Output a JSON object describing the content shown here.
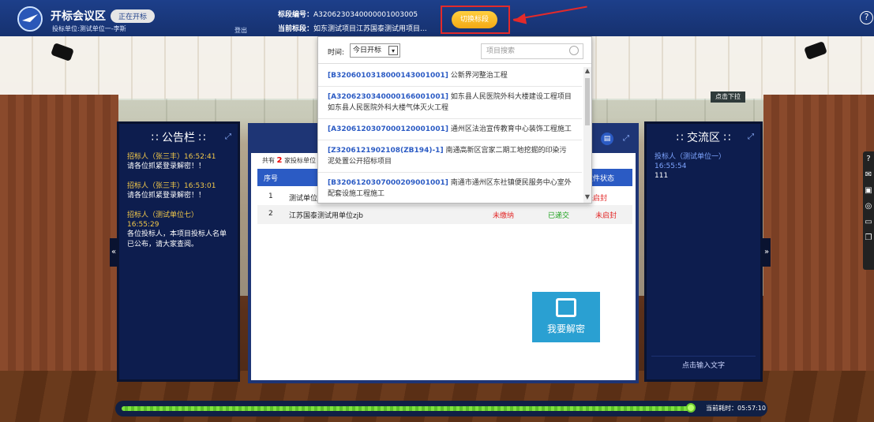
{
  "header": {
    "app_title": "开标会议区",
    "status": "正在开标",
    "bidder_info": "投标单位:测试单位一-李斯",
    "logout": "登出",
    "section_no_label": "标段编号：",
    "section_no_value": "A3206230340000001003005",
    "current_label": "当前标段：",
    "current_value": "如东测试项目江苏国泰测试用项目...",
    "switch_button": "切换标段",
    "help": "?"
  },
  "popup": {
    "time_label": "时间:",
    "time_value": "今日开标",
    "search_placeholder": "项目搜索",
    "items": [
      {
        "code": "[B3206010318000143001001]",
        "name": "公新界河整治工程"
      },
      {
        "code": "[A3206230340000166001001]",
        "name": "如东县人民医院外科大楼建设工程项目如东县人民医院外科大楼气体灭火工程"
      },
      {
        "code": "[A3206120307000120001001]",
        "name": "通州区法治宣传教育中心装饰工程施工"
      },
      {
        "code": "[Z3206121902108(ZB194)-1]",
        "name": "南通高新区宫家二期工地挖掘的印染污泥处置公开招标项目"
      },
      {
        "code": "[B3206120307000209001001]",
        "name": "南通市通州区东社镇便民服务中心室外配套设施工程施工"
      }
    ]
  },
  "notice": {
    "title": "公告栏",
    "messages": [
      {
        "head": "招标人（张三丰）16:52:41",
        "body": "请各位抓紧登录解密！！"
      },
      {
        "head": "招标人（张三丰）16:53:01",
        "body": "请各位抓紧登录解密！！"
      },
      {
        "head": "招标人（测试单位七）16:55:29",
        "body": "各位投标人，本项目投标人名单已公布，请大家查阅。"
      }
    ]
  },
  "chat": {
    "title": "交流区",
    "dropdown_tag": "点击下拉",
    "messages": [
      {
        "head": "投标人（测试单位一）16:55:54",
        "body": "111"
      }
    ],
    "input_placeholder": "点击输入文字"
  },
  "center": {
    "count_prefix": "共有",
    "count_value": "2",
    "count_suffix": "家投标单位",
    "columns": {
      "no": "序号",
      "status": "文件状态"
    },
    "rows": [
      {
        "no": "1",
        "unit": "测试单位",
        "fee": "",
        "deposit": "",
        "status": "未启封"
      },
      {
        "no": "2",
        "unit": "江苏国泰测试用单位zjb",
        "fee": "未缴纳",
        "deposit": "已递交",
        "status": "未启封"
      }
    ],
    "unlock_button": "我要解密"
  },
  "progress": {
    "elapsed_label": "当前耗时：05:57:10",
    "fraction": 0.98
  },
  "colors": {
    "header": "#1d3f8a",
    "accent": "#2b5bc4",
    "switch": "#f4a914",
    "highlight": "#e32a2a",
    "progress": "#7ee23e"
  }
}
